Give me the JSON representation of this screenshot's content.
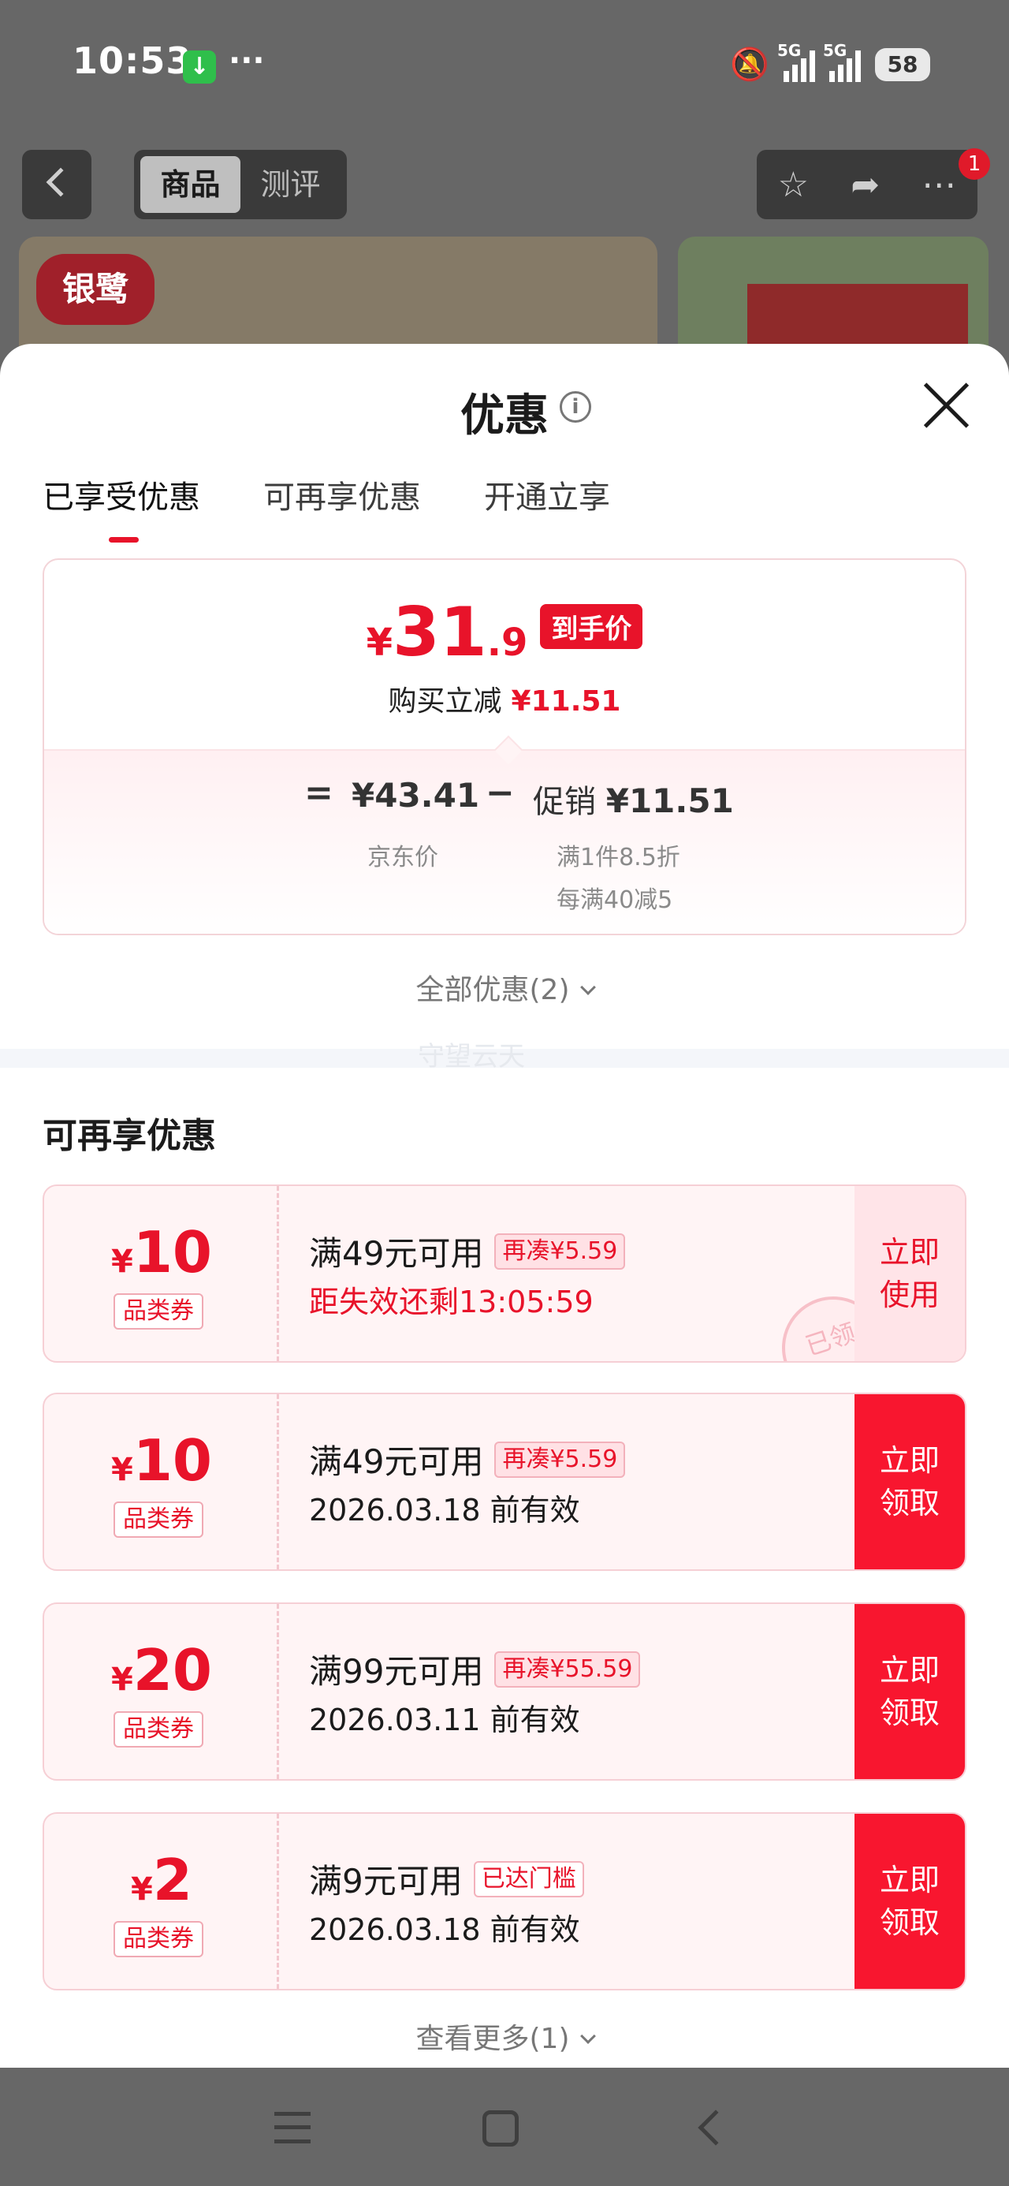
{
  "status_bar": {
    "time": "10:53",
    "more": "···",
    "signal1_tag": "5G",
    "signal2_tag": "5G",
    "battery": "58"
  },
  "header": {
    "tabs": [
      "商品",
      "测评"
    ],
    "notification_count": "1"
  },
  "background": {
    "brand_logo": "银鹭"
  },
  "sheet": {
    "title": "优惠",
    "tabs": [
      "已享受优惠",
      "可再享优惠",
      "开通立享"
    ],
    "price_card": {
      "yen": "¥",
      "price_int": "31",
      "price_dec": ".9",
      "price_tag": "到手价",
      "sub_label": "购买立减",
      "sub_value": "¥11.51",
      "eq": "=",
      "jd_price": "¥43.41",
      "minus": "−",
      "promo_label": "促销",
      "promo_value": "¥11.51",
      "jd_label": "京东价",
      "promo_line1": "满1件8.5折",
      "promo_line2": "每满40减5"
    },
    "all_discounts": "全部优惠(2)",
    "watermark": "守望云天",
    "section_title": "可再享优惠",
    "coupons": [
      {
        "yen": "¥",
        "amount": "10",
        "kind": "品类券",
        "cond": "满49元可用",
        "chip": "再凑¥5.59",
        "sub": "距失效还剩13:05:59",
        "action": "立即使用",
        "stamp": "已领"
      },
      {
        "yen": "¥",
        "amount": "10",
        "kind": "品类券",
        "cond": "满49元可用",
        "chip": "再凑¥5.59",
        "sub": "2026.03.18 前有效",
        "action": "立即领取"
      },
      {
        "yen": "¥",
        "amount": "20",
        "kind": "品类券",
        "cond": "满99元可用",
        "chip": "再凑¥55.59",
        "sub": "2026.03.11 前有效",
        "action": "立即领取"
      },
      {
        "yen": "¥",
        "amount": "2",
        "kind": "品类券",
        "cond": "满9元可用",
        "chip": "已达门槛",
        "sub": "2026.03.18 前有效",
        "action": "立即领取"
      }
    ],
    "see_more": "查看更多(1)"
  },
  "colors": {
    "accent": "#e8132a",
    "coupon_bg": "#fff4f5"
  }
}
